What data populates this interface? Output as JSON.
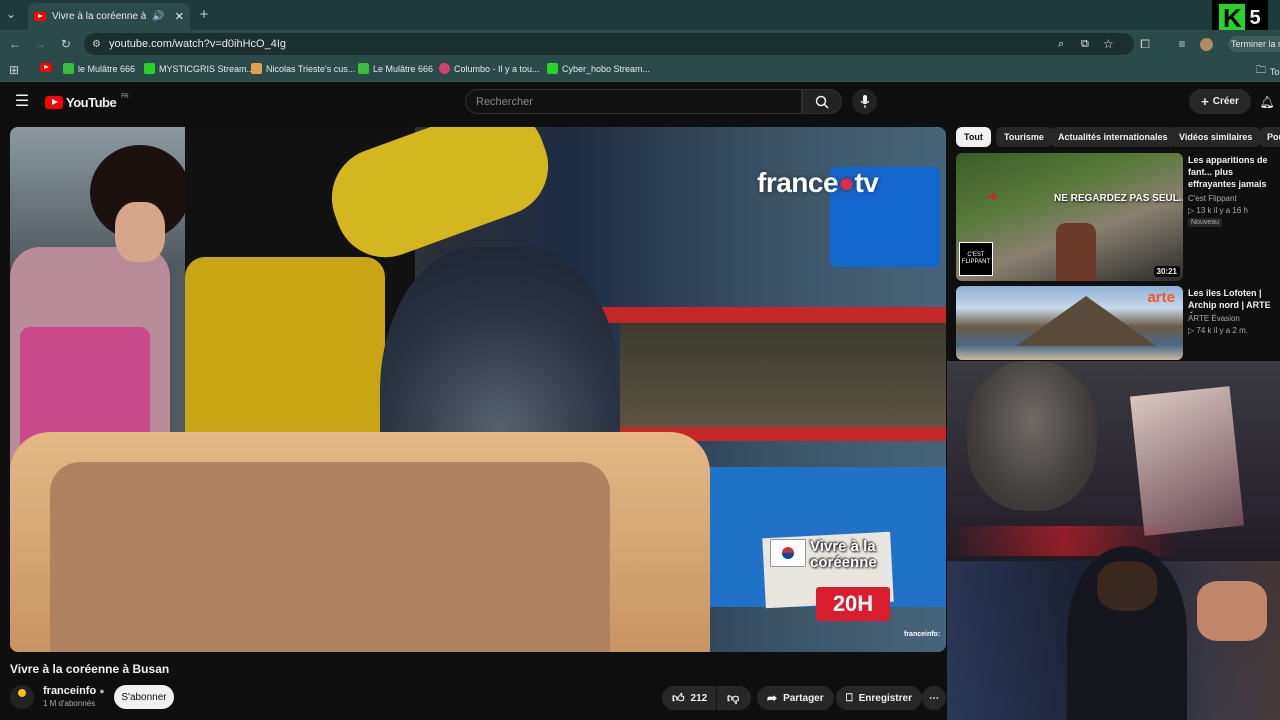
{
  "browser": {
    "tab_title": "Vivre à la coréenne à Busan",
    "url": "youtube.com/watch?v=d0ihHcO_4Ig",
    "profile_label": "Terminer la m",
    "overlay_badge": "5",
    "bookmarks": [
      {
        "label": "le Mulâtre 666",
        "color": "#3bbd3b"
      },
      {
        "label": "MYSTICGRIS Stream...",
        "color": "#26d426"
      },
      {
        "label": "Nicolas Trieste's cus...",
        "color": "#e0a050"
      },
      {
        "label": "Le Mulâtre 666",
        "color": "#3bbd3b"
      },
      {
        "label": "Columbo - Il y a tou...",
        "color": "#d04070"
      },
      {
        "label": "Cyber_hobo Stream...",
        "color": "#26d426"
      }
    ],
    "bookmarks_right": "To"
  },
  "youtube": {
    "logo_text": "YouTube",
    "logo_region": "FR",
    "search_placeholder": "Rechercher",
    "create_label": "Créer"
  },
  "video": {
    "title": "Vivre à la coréenne à Busan",
    "watermark": "france·tv",
    "watermark_left": "france",
    "watermark_right": "tv",
    "promo_title": "Vivre à la coréenne",
    "promo_time": "20H",
    "corner_logo": "franceinfo:",
    "channel_name": "franceinfo",
    "channel_subs": "1 M d'abonnés",
    "subscribe_label": "S'abonner",
    "likes": "212",
    "share_label": "Partager",
    "save_label": "Enregistrer"
  },
  "chips": [
    "Tout",
    "Tourisme",
    "Actualités internationales",
    "Vidéos similaires",
    "Pou"
  ],
  "recommendations": [
    {
      "title": "Les apparitions de fant... plus effrayantes jamais (PARANORMAL)",
      "channel": "C'est Flippant",
      "meta": "13 k  il y a 16 h",
      "badge": "Nouveau",
      "duration": "30:21",
      "thumb_text": "NE REGARDEZ PAS SEUL...",
      "thumb_logo": "C'EST FLIPPANT"
    },
    {
      "title": "Les îles Lofoten | Archip nord | ARTE Évasion",
      "channel": "ARTE Évasion",
      "meta": "74 k  il y a 2 m.",
      "thumb_logo": "arte"
    }
  ]
}
